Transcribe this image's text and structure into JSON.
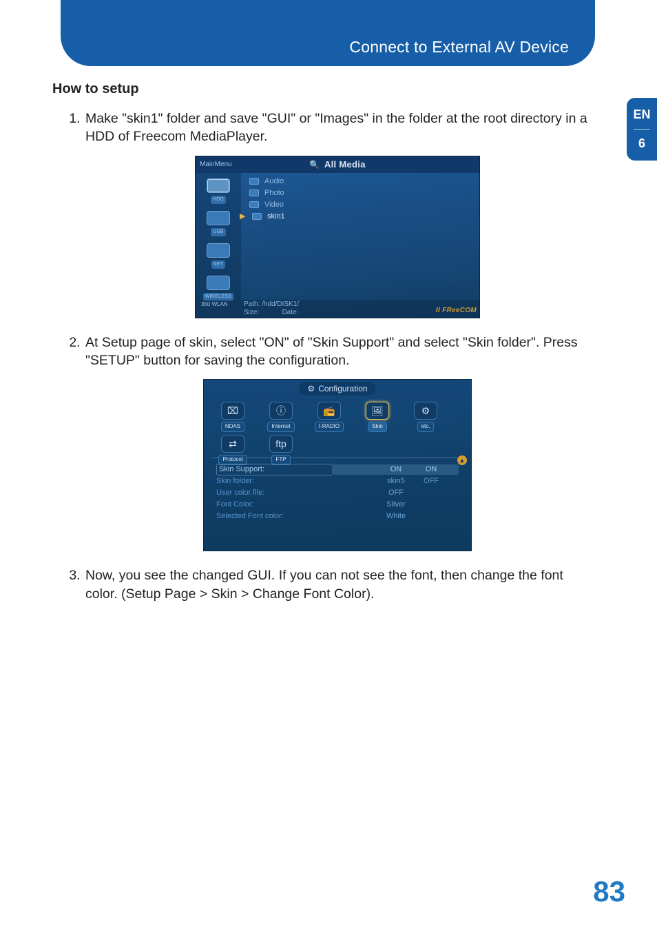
{
  "header": {
    "title": "Connect to External AV Device"
  },
  "sideTab": {
    "lang": "EN",
    "chapter": "6"
  },
  "section": {
    "heading": "How to setup"
  },
  "steps": {
    "s1": "Make \"skin1\" folder and save \"GUI\" or \"Images\" in the folder at the root directory in a HDD of Freecom MediaPlayer.",
    "s2": "At Setup page of skin, select \"ON\" of \"Skin Support\" and select \"Skin folder\". Press \"SETUP\" button for saving the configuration.",
    "s3": "Now, you see the changed GUI. If you can not see the font, then change the font color. (Setup Page > Skin > Change Font Color)."
  },
  "shot1": {
    "topMenu": "MainMenu",
    "title": "All Media",
    "sideLabels": {
      "a": "HDD",
      "b": "USB",
      "c": "NET",
      "d": "WIRELESS"
    },
    "items": {
      "audio": "Audio",
      "photo": "Photo",
      "video": "Video",
      "skin1": "skin1"
    },
    "status": {
      "pathLabel": "Path:",
      "pathValue": "/hdd/DISK1/",
      "sizeLabel": "Size:",
      "dateLabel": "Date:",
      "model": "350 WLAN",
      "brand": "II FReeCOM"
    }
  },
  "shot2": {
    "title": "Configuration",
    "tabs": {
      "ndas": "NDAS",
      "internet": "Internet",
      "iradio": "I-RADIO",
      "skin": "Skin",
      "etc": "etc.",
      "protocol": "Protocol",
      "ftp": "FTP"
    },
    "rows": {
      "skinSupport": {
        "k": "Skin Support:",
        "v": "ON"
      },
      "skinFolder": {
        "k": "Skin folder:",
        "v": "skin5"
      },
      "userColor": {
        "k": "User color file:",
        "v": "OFF"
      },
      "fontColor": {
        "k": "Font Color:",
        "v": "Silver"
      },
      "selFontColor": {
        "k": "Selected Font color:",
        "v": "White"
      }
    },
    "options": {
      "on": "ON",
      "off": "OFF"
    }
  },
  "pageNumber": "83"
}
